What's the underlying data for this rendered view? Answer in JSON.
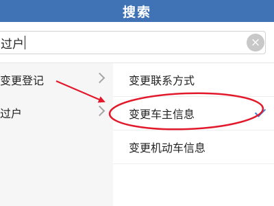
{
  "header": {
    "title": "搜索"
  },
  "search": {
    "value": "过户",
    "clear_icon": "clear-icon"
  },
  "left_menu": {
    "items": [
      {
        "label": "变更登记"
      },
      {
        "label": "过户"
      }
    ]
  },
  "right_menu": {
    "items": [
      {
        "label": "变更联系方式",
        "selected": false
      },
      {
        "label": "变更车主信息",
        "selected": true
      },
      {
        "label": "变更机动车信息",
        "selected": false
      }
    ]
  },
  "colors": {
    "header_bg": "#3f73b6",
    "annotation": "#e2182b",
    "check": "#3d7bd6"
  },
  "icons": [
    "clear-icon",
    "chevron-right-icon",
    "checkmark-icon",
    "annotation-arrow",
    "annotation-ellipse"
  ]
}
